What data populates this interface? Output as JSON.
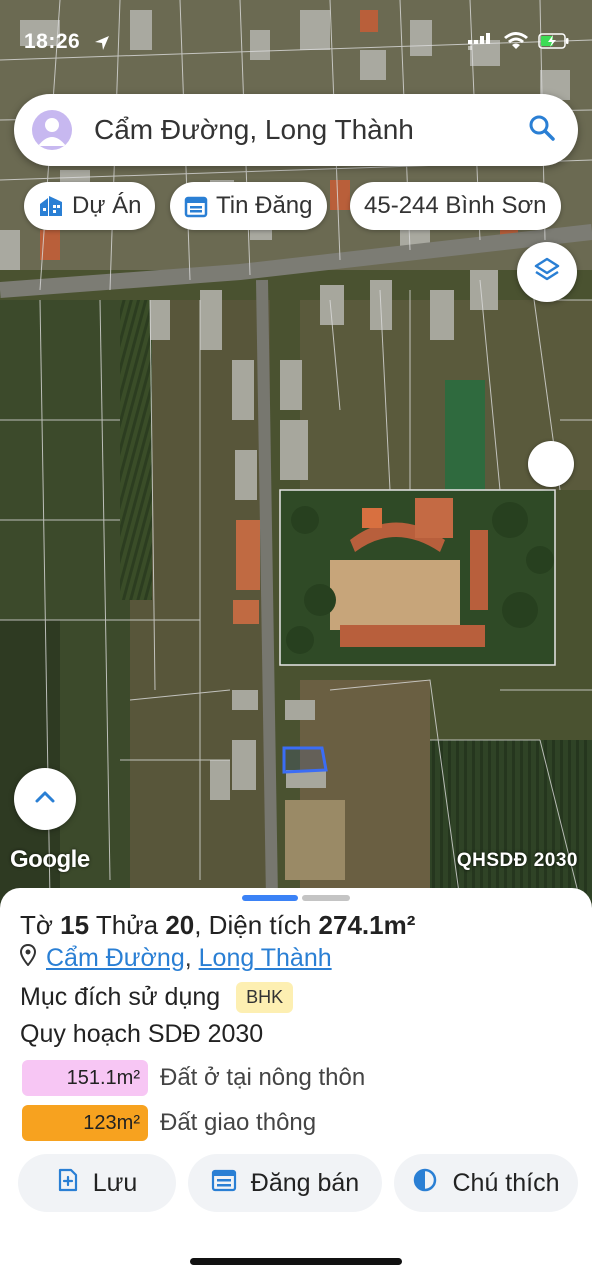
{
  "status_bar": {
    "time": "18:26"
  },
  "search": {
    "text": "Cẩm Đường, Long Thành"
  },
  "chips": [
    {
      "label": "Dự Án",
      "icon": "building-icon"
    },
    {
      "label": "Tin Đăng",
      "icon": "calendar-icon"
    },
    {
      "label": "45-244 Bình Sơn"
    }
  ],
  "map": {
    "attribution": "Google",
    "layer_label": "QHSDĐ 2030"
  },
  "parcel": {
    "title_prefix": "Tờ",
    "sheet_no": "15",
    "plot_word": "Thửa",
    "plot_no": "20",
    "area_label": ", Diện tích",
    "area_value": "274.1m²",
    "commune": "Cẩm Đường",
    "separator": ",",
    "district": "Long Thành",
    "purpose_label": "Mục đích sử dụng",
    "purpose_code": "BHK",
    "planning_title": "Quy hoạch SDĐ 2030",
    "zones": [
      {
        "area": "151.1m²",
        "label": "Đất ở tại nông thôn",
        "color": "#f7c6f4"
      },
      {
        "area": "123m²",
        "label": "Đất giao thông",
        "color": "#f7a21f"
      }
    ]
  },
  "actions": [
    {
      "label": "Lưu",
      "icon": "bookmark-add-icon"
    },
    {
      "label": "Đăng bán",
      "icon": "calendar-icon"
    },
    {
      "label": "Chú thích",
      "icon": "legend-icon"
    }
  ],
  "colors": {
    "accent": "#2a7fd4",
    "link": "#2a7fd4"
  }
}
